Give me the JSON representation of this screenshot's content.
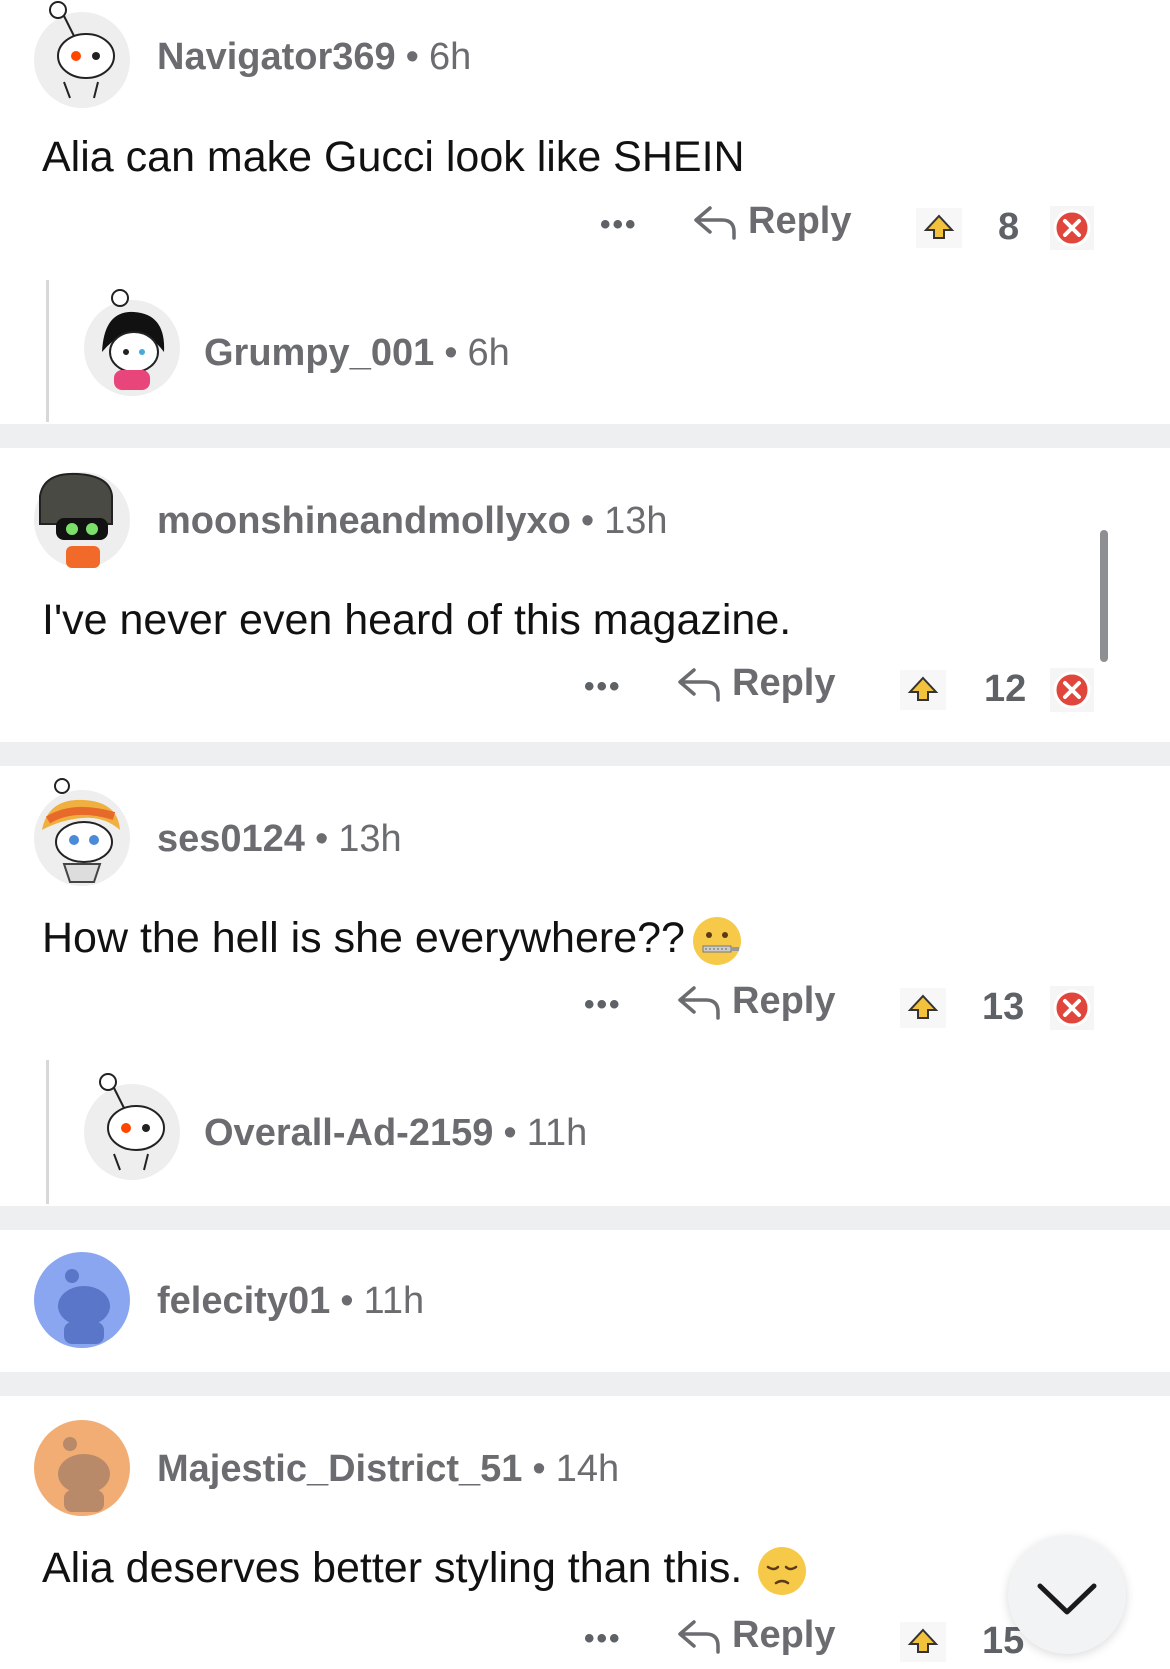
{
  "comments": [
    {
      "user": "Navigator369",
      "time": "6h",
      "text": "Alia can make Gucci look like SHEIN",
      "reply_label": "Reply",
      "more": "•••",
      "score": "8"
    },
    {
      "user": "Grumpy_001",
      "time": "6h"
    },
    {
      "user": "moonshineandmollyxo",
      "time": "13h",
      "text": "I've never even heard of this magazine.",
      "reply_label": "Reply",
      "more": "•••",
      "score": "12"
    },
    {
      "user": "ses0124",
      "time": "13h",
      "text": "How the hell is she everywhere??",
      "reply_label": "Reply",
      "more": "•••",
      "score": "13"
    },
    {
      "user": "Overall-Ad-2159",
      "time": "11h"
    },
    {
      "user": "felecity01",
      "time": "11h"
    },
    {
      "user": "Majestic_District_51",
      "time": "14h",
      "text": "Alia deserves better styling than this.",
      "reply_label": "Reply",
      "more": "•••",
      "score": "15"
    }
  ],
  "separator": "•",
  "icons": {
    "reply": "reply-arrow-icon",
    "upvote": "upvote-icon",
    "downvote": "downvote-icon",
    "collapse": "chevron-down-icon",
    "emoji_zipper": "zipper-mouth-face-emoji",
    "emoji_pensive": "pensive-face-emoji"
  },
  "colors": {
    "separator_band": "#edeff1",
    "downvote": "#e0463b",
    "upvote": "#f2c23c"
  }
}
